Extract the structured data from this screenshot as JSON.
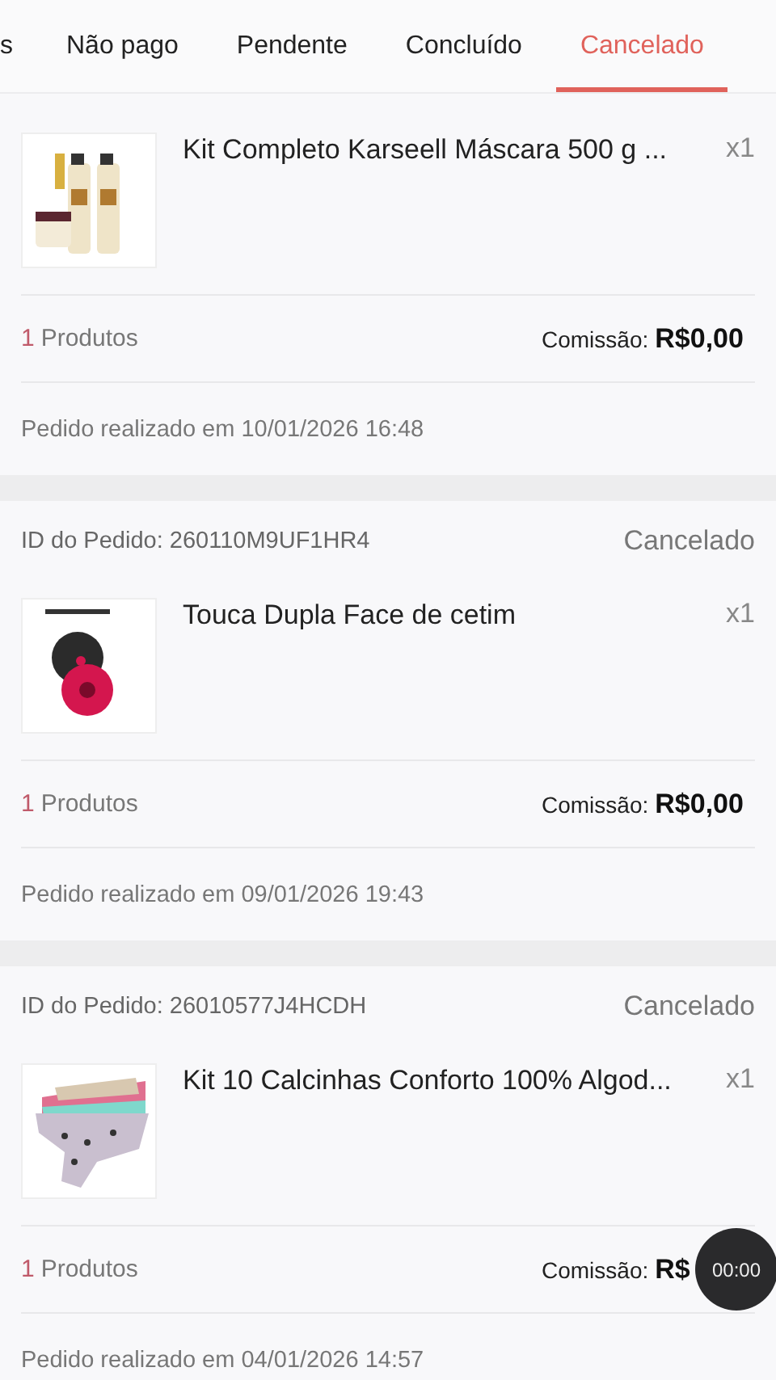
{
  "tabs": [
    {
      "label": "s",
      "selected": false
    },
    {
      "label": "Não pago",
      "selected": false
    },
    {
      "label": "Pendente",
      "selected": false
    },
    {
      "label": "Concluído",
      "selected": false
    },
    {
      "label": "Cancelado",
      "selected": true
    }
  ],
  "orders": [
    {
      "product": {
        "kind": "picture",
        "name": "Kit Completo Karseell Máscara 500 g ...",
        "quantity": "x1"
      },
      "count": "1",
      "count_label": "Produtos",
      "commission_label": "Comissão:",
      "commission": "R$0,00",
      "date": "Pedido realizado em 10/01/2026 16:48"
    },
    {
      "order_id": "ID do Pedido: 260110M9UF1HR4",
      "status": "Cancelado",
      "product": {
        "kind": "picture",
        "name": "Touca Dupla Face de cetim",
        "quantity": "x1"
      },
      "count": "1",
      "count_label": "Produtos",
      "commission_label": "Comissão:",
      "commission": "R$0,00",
      "date": "Pedido realizado em 09/01/2026 19:43"
    },
    {
      "order_id": "ID do Pedido: 26010577J4HCDH",
      "status": "Cancelado",
      "product": {
        "kind": "picture",
        "name": "Kit 10 Calcinhas Conforto 100% Algod...",
        "quantity": "x1"
      },
      "count": "1",
      "count_label": "Produtos",
      "commission_label": "Comissão:",
      "commission": "R$",
      "date": "Pedido realizado em 04/01/2026 14:57"
    }
  ],
  "recording_timer": "00:00"
}
